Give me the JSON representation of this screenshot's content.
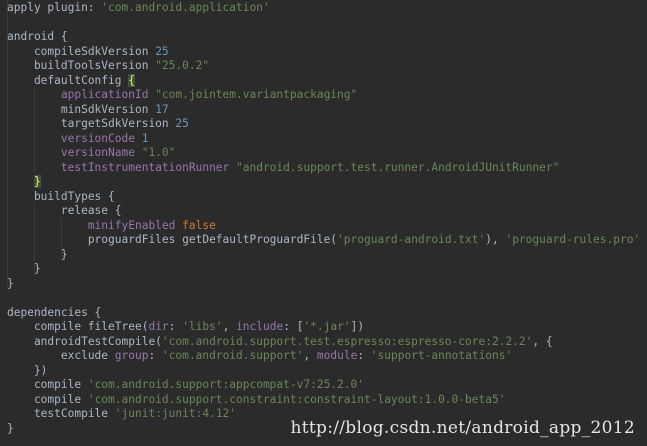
{
  "code_lines": [
    [
      {
        "t": "apply plugin: ",
        "c": "id"
      },
      {
        "t": "'com.android.application'",
        "c": "str"
      }
    ],
    [],
    [
      {
        "t": "android {",
        "c": "id"
      }
    ],
    [
      {
        "t": "    compileSdkVersion ",
        "c": "id"
      },
      {
        "t": "25",
        "c": "num"
      }
    ],
    [
      {
        "t": "    buildToolsVersion ",
        "c": "id"
      },
      {
        "t": "\"25.0.2\"",
        "c": "str"
      }
    ],
    [
      {
        "t": "    defaultConfig ",
        "c": "id"
      },
      {
        "t": "{",
        "c": "hl"
      }
    ],
    [
      {
        "t": "        applicationId ",
        "c": "prop"
      },
      {
        "t": "\"com.jointem.variantpackaging\"",
        "c": "str"
      }
    ],
    [
      {
        "t": "        minSdkVersion ",
        "c": "id"
      },
      {
        "t": "17",
        "c": "num"
      }
    ],
    [
      {
        "t": "        targetSdkVersion ",
        "c": "id"
      },
      {
        "t": "25",
        "c": "num"
      }
    ],
    [
      {
        "t": "        versionCode ",
        "c": "prop"
      },
      {
        "t": "1",
        "c": "num"
      }
    ],
    [
      {
        "t": "        versionName ",
        "c": "prop"
      },
      {
        "t": "\"1.0\"",
        "c": "str"
      }
    ],
    [
      {
        "t": "        testInstrumentationRunner ",
        "c": "prop"
      },
      {
        "t": "\"android.support.test.runner.AndroidJUnitRunner\"",
        "c": "str"
      }
    ],
    [
      {
        "t": "    ",
        "c": "id"
      },
      {
        "t": "}",
        "c": "hl"
      }
    ],
    [
      {
        "t": "    buildTypes {",
        "c": "id"
      }
    ],
    [
      {
        "t": "        release {",
        "c": "id"
      }
    ],
    [
      {
        "t": "            minifyEnabled ",
        "c": "prop"
      },
      {
        "t": "false",
        "c": "kw"
      }
    ],
    [
      {
        "t": "            proguardFiles getDefaultProguardFile(",
        "c": "id"
      },
      {
        "t": "'proguard-android.txt'",
        "c": "str"
      },
      {
        "t": "), ",
        "c": "id"
      },
      {
        "t": "'proguard-rules.pro'",
        "c": "str"
      }
    ],
    [
      {
        "t": "        }",
        "c": "id"
      }
    ],
    [
      {
        "t": "    }",
        "c": "id"
      }
    ],
    [
      {
        "t": "}",
        "c": "id"
      }
    ],
    [],
    [
      {
        "t": "dependencies {",
        "c": "id"
      }
    ],
    [
      {
        "t": "    compile fileTree(",
        "c": "id"
      },
      {
        "t": "dir",
        "c": "prop"
      },
      {
        "t": ": ",
        "c": "id"
      },
      {
        "t": "'libs'",
        "c": "str"
      },
      {
        "t": ", ",
        "c": "id"
      },
      {
        "t": "include",
        "c": "prop"
      },
      {
        "t": ": [",
        "c": "id"
      },
      {
        "t": "'*.jar'",
        "c": "str"
      },
      {
        "t": "])",
        "c": "id"
      }
    ],
    [
      {
        "t": "    androidTestCompile(",
        "c": "id"
      },
      {
        "t": "'com.android.support.test.espresso:espresso-core:2.2.2'",
        "c": "str"
      },
      {
        "t": ", {",
        "c": "id"
      }
    ],
    [
      {
        "t": "        exclude ",
        "c": "id"
      },
      {
        "t": "group",
        "c": "prop"
      },
      {
        "t": ": ",
        "c": "id"
      },
      {
        "t": "'com.android.support'",
        "c": "str"
      },
      {
        "t": ", ",
        "c": "id"
      },
      {
        "t": "module",
        "c": "prop"
      },
      {
        "t": ": ",
        "c": "id"
      },
      {
        "t": "'support-annotations'",
        "c": "str"
      }
    ],
    [
      {
        "t": "    })",
        "c": "id"
      }
    ],
    [
      {
        "t": "    compile ",
        "c": "id"
      },
      {
        "t": "'com.android.support:appcompat-v7:25.2.0'",
        "c": "str"
      }
    ],
    [
      {
        "t": "    compile ",
        "c": "id"
      },
      {
        "t": "'com.android.support.constraint:constraint-layout:1.0.0-beta5'",
        "c": "str"
      }
    ],
    [
      {
        "t": "    testCompile ",
        "c": "id"
      },
      {
        "t": "'junit:junit:4.12'",
        "c": "str"
      }
    ],
    [
      {
        "t": "}",
        "c": "id"
      }
    ]
  ],
  "watermark": "http://blog.csdn.net/android_app_2012",
  "colors": {
    "background": "#2b2b2b",
    "identifier": "#a9b7c6",
    "string": "#6a8759",
    "number": "#6897bb",
    "keyword": "#cc7832",
    "property": "#9876aa",
    "brace_highlight": "#ffef28"
  }
}
